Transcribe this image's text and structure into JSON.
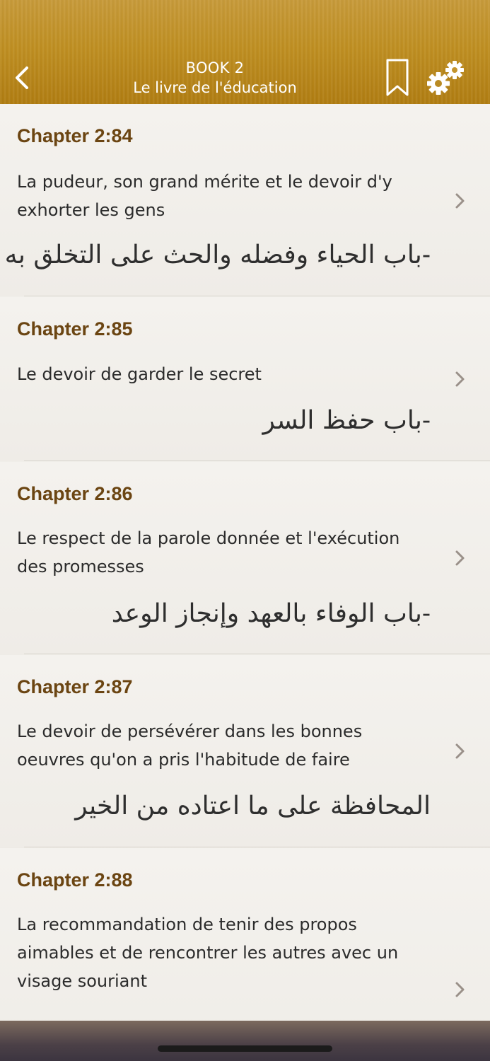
{
  "header": {
    "book_label": "BOOK 2",
    "book_title": "Le livre de l'éducation",
    "back_icon": "chevron-left-icon",
    "bookmark_icon": "bookmark-icon",
    "settings_icon": "gears-icon",
    "accent_color": "#bf8f22"
  },
  "chapters": [
    {
      "number": "Chapter 2:84",
      "french": "La pudeur, son grand mérite et le devoir d'y exhorter les gens",
      "arabic": "-باب الحياء وفضله والحث على التخلق به"
    },
    {
      "number": "Chapter 2:85",
      "french": "Le devoir de garder le secret",
      "arabic": "-باب حفظ السر"
    },
    {
      "number": "Chapter 2:86",
      "french": "Le respect de la parole donnée et l'exécution des promesses",
      "arabic": "-باب الوفاء بالعهد وإنجاز الوعد"
    },
    {
      "number": "Chapter 2:87",
      "french": "Le devoir de persévérer dans les bonnes oeuvres qu'on a pris l'habitude de faire",
      "arabic": "المحافظة على ما اعتاده من الخير"
    },
    {
      "number": "Chapter 2:88",
      "french": "La recommandation de tenir des propos aimables et de rencontrer les autres avec un visage souriant",
      "arabic": ""
    }
  ],
  "colors": {
    "chapter_title": "#6b4512",
    "chevron": "#9a9089"
  }
}
